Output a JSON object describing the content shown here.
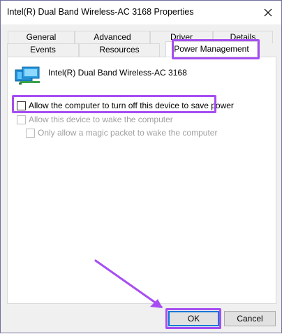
{
  "window": {
    "title": "Intel(R) Dual Band Wireless-AC 3168 Properties"
  },
  "tabs": {
    "row1": [
      {
        "label": "General"
      },
      {
        "label": "Advanced"
      },
      {
        "label": "Driver"
      },
      {
        "label": "Details"
      }
    ],
    "row2": [
      {
        "label": "Events"
      },
      {
        "label": "Resources"
      },
      {
        "label": "Power Management"
      }
    ],
    "active": "Power Management"
  },
  "device": {
    "name": "Intel(R) Dual Band Wireless-AC 3168",
    "icon": "network-adapter-icon"
  },
  "options": {
    "allow_turn_off": {
      "label": "Allow the computer to turn off this device to save power",
      "checked": false,
      "enabled": true
    },
    "allow_wake": {
      "label": "Allow this device to wake the computer",
      "checked": false,
      "enabled": false
    },
    "magic_packet": {
      "label": "Only allow a magic packet to wake the computer",
      "checked": false,
      "enabled": false
    }
  },
  "buttons": {
    "ok": "OK",
    "cancel": "Cancel"
  },
  "colors": {
    "highlight": "#a64df2",
    "ok_focus": "#0078d7"
  }
}
